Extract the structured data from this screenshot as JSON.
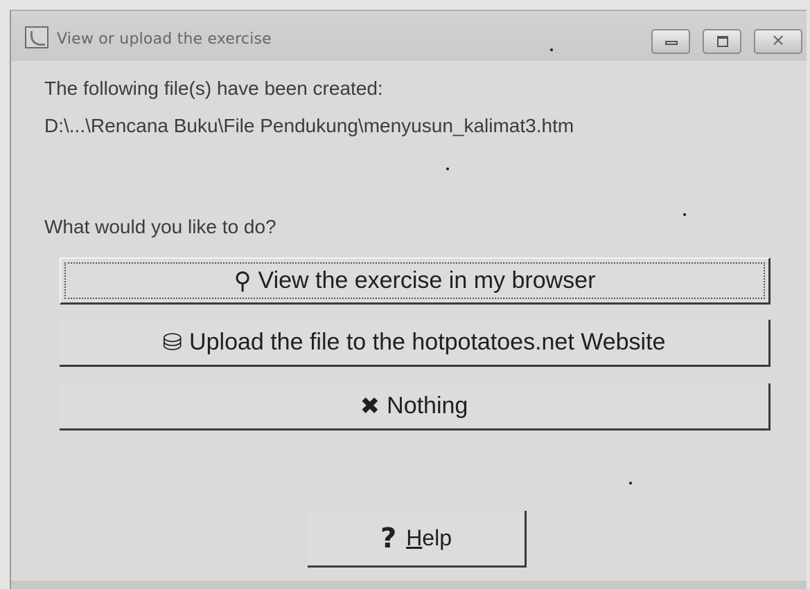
{
  "window": {
    "title": "View or upload the exercise",
    "close_glyph": "✕"
  },
  "message": {
    "created_label": "The following file(s) have been created:",
    "file_path": "D:\\...\\Rencana Buku\\File Pendukung\\menyusun_kalimat3.htm",
    "question": "What would you like to do?"
  },
  "actions": [
    {
      "label": "View the exercise in my browser",
      "icon": "magnifier-icon",
      "glyph": "⚲"
    },
    {
      "label": "Upload the file to the hotpotatoes.net Website",
      "icon": "upload-icon",
      "glyph": "⛁"
    },
    {
      "label": "Nothing",
      "icon": "x-mark-icon",
      "glyph": "✖"
    }
  ],
  "help": {
    "glyph": "?",
    "mnemonic": "H",
    "rest": "elp"
  }
}
